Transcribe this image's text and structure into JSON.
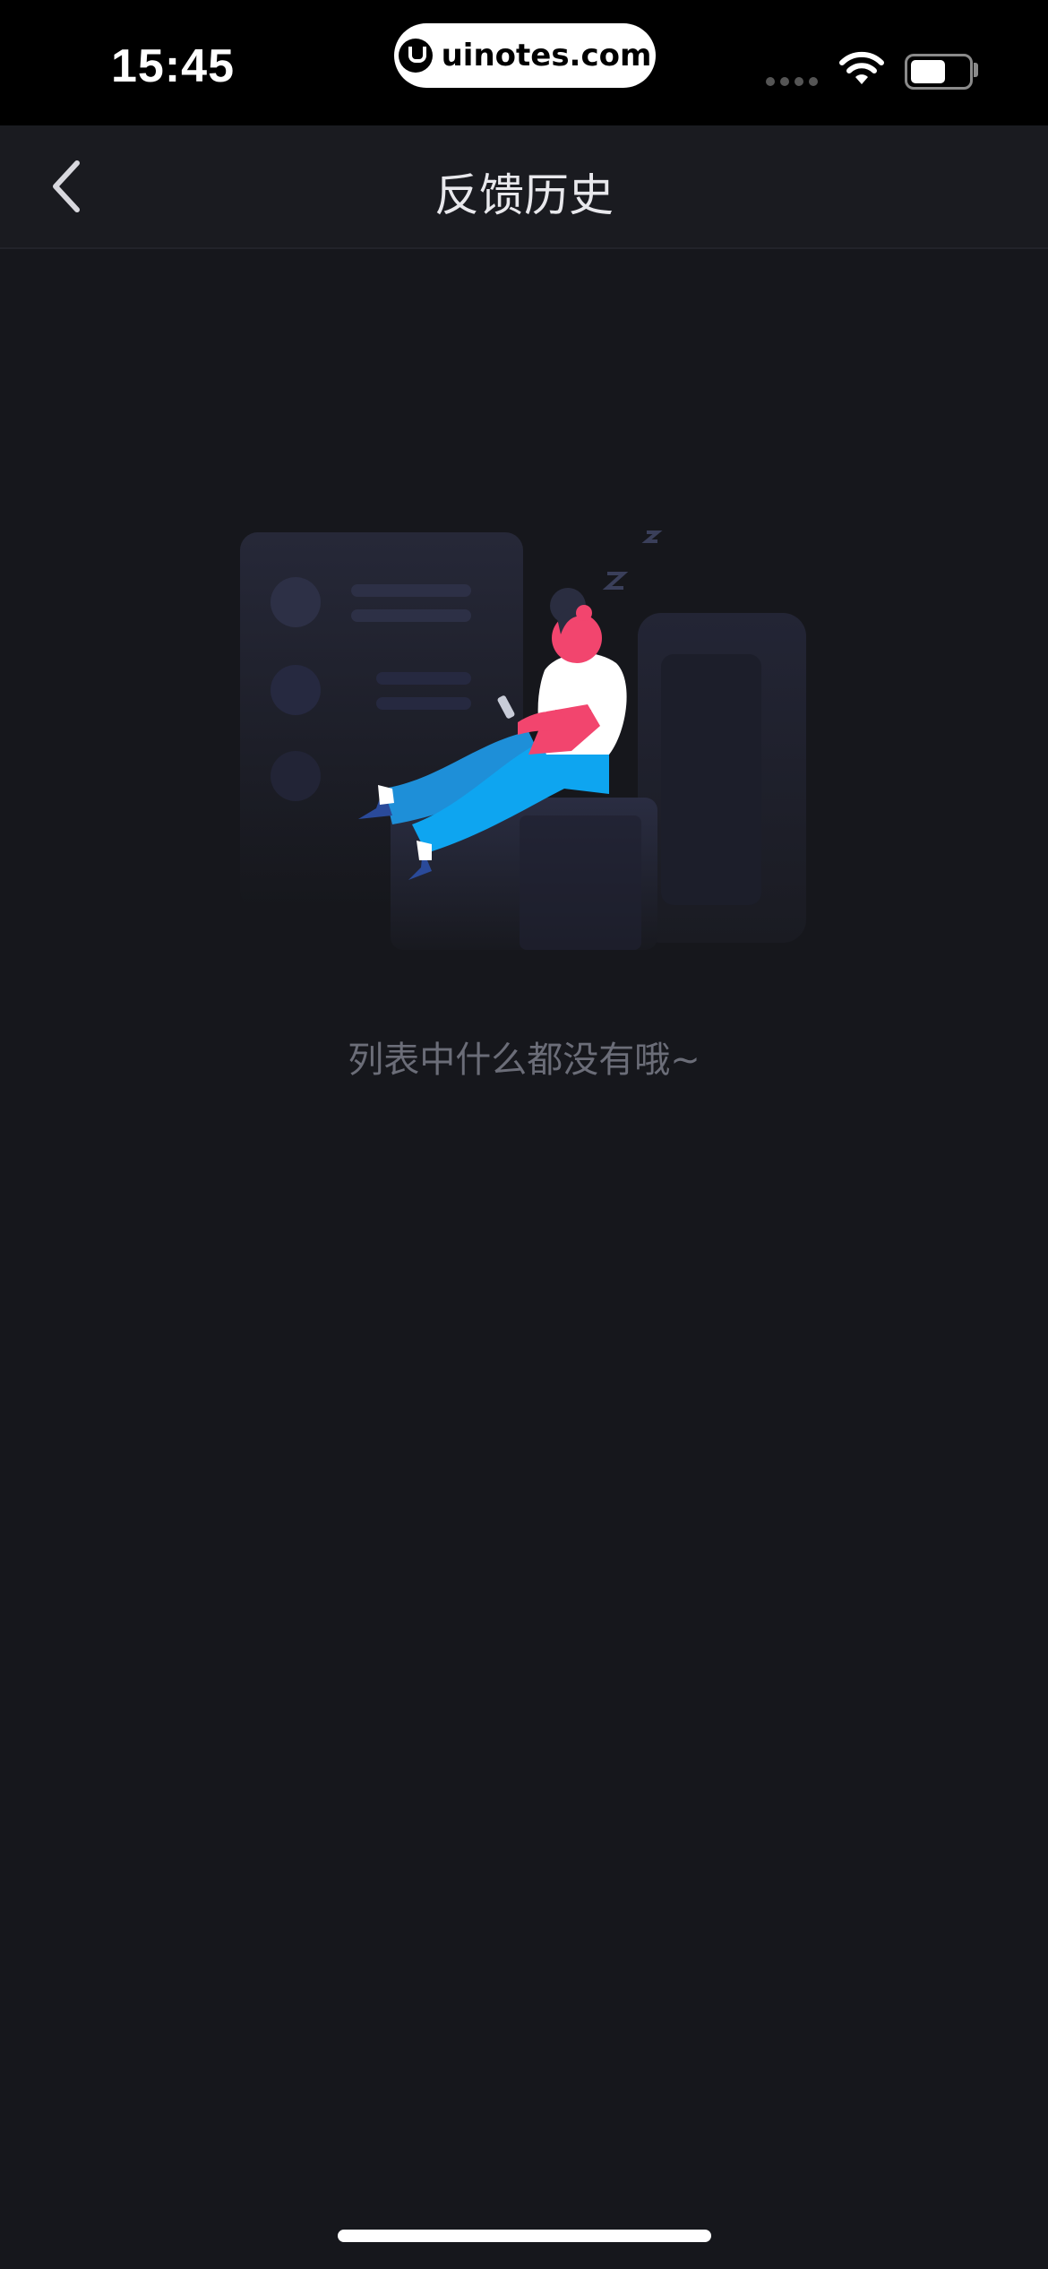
{
  "status_bar": {
    "time": "15:45",
    "watermark": "uinotes.com",
    "icons": [
      "signal-icon",
      "wifi-icon",
      "battery-icon"
    ]
  },
  "nav": {
    "back_icon": "chevron-left-icon",
    "title": "反馈历史"
  },
  "empty_state": {
    "illustration": "person-relaxing-with-phone-illustration",
    "message": "列表中什么都没有哦~"
  },
  "colors": {
    "background": "#16171c",
    "nav_background": "#1a1b20",
    "accent_pink": "#f2456e",
    "accent_blue": "#0ea5f0"
  }
}
